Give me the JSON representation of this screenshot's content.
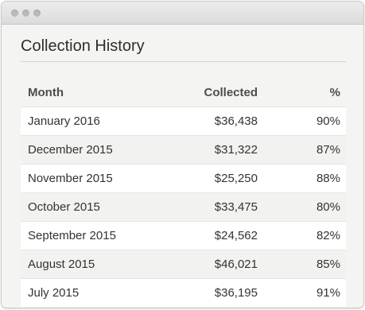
{
  "window": {
    "controls": [
      "close",
      "minimize",
      "zoom"
    ]
  },
  "panel": {
    "title": "Collection History",
    "columns": {
      "month": "Month",
      "collected": "Collected",
      "percent": "%"
    },
    "rows": [
      {
        "month": "January 2016",
        "collected": "$36,438",
        "percent": "90%"
      },
      {
        "month": "December 2015",
        "collected": "$31,322",
        "percent": "87%"
      },
      {
        "month": "November 2015",
        "collected": "$25,250",
        "percent": "88%"
      },
      {
        "month": "October 2015",
        "collected": "$33,475",
        "percent": "80%"
      },
      {
        "month": "September 2015",
        "collected": "$24,562",
        "percent": "82%"
      },
      {
        "month": "August 2015",
        "collected": "$46,021",
        "percent": "85%"
      },
      {
        "month": "July 2015",
        "collected": "$36,195",
        "percent": "91%"
      }
    ]
  },
  "colors": {
    "window_bg": "#f4f4f2",
    "row_white": "#ffffff",
    "row_alt": "#f2f2f0",
    "text": "#333333"
  }
}
